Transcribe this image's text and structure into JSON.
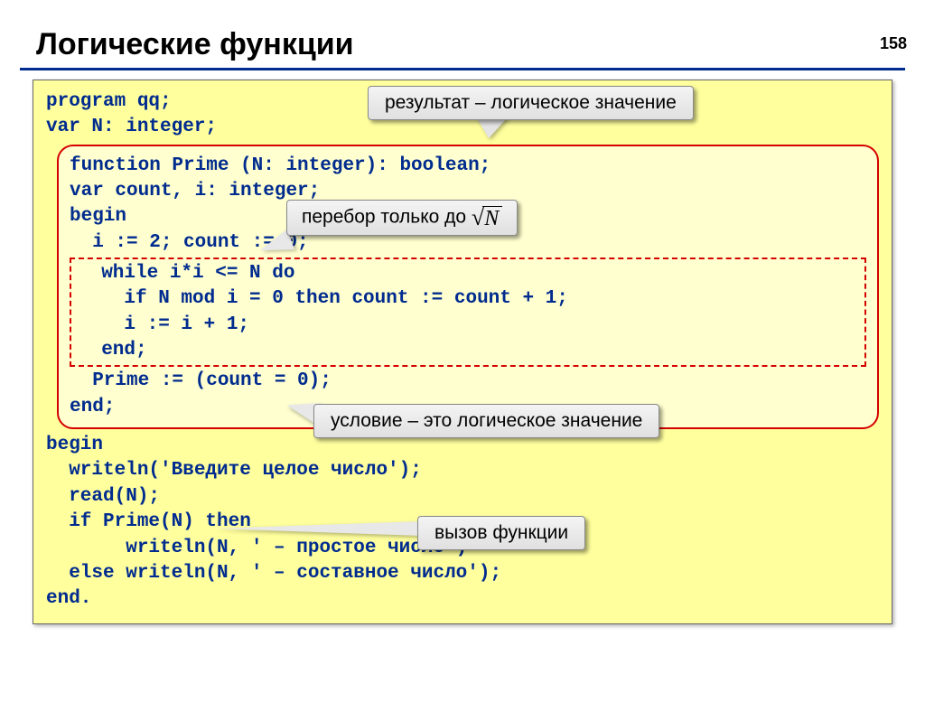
{
  "page_number": "158",
  "title": "Логические функции",
  "code": {
    "l1": "program qq;",
    "l2": "var N: integer;",
    "f1": "function Prime (N: integer): boolean;",
    "f2": "var count, i: integer;",
    "f3": "begin",
    "f4": "  i := 2; count := 0;",
    "d1": "  while i*i <= N do",
    "d2": "    if N mod i = 0 then count := count + 1;",
    "d3": "    i := i + 1;",
    "d4": "  end;",
    "f5": "  Prime := (count = 0);",
    "f6": "end;",
    "l3": "begin",
    "l4": "  writeln('Введите целое число');",
    "l5": "  read(N);",
    "l6": "  if Prime(N) then",
    "l7": "       writeln(N, ' – простое число')",
    "l8": "  else writeln(N, ' – составное число');",
    "l9": "end."
  },
  "callouts": {
    "c1": "результат – логическое значение",
    "c2_prefix": "перебор только до ",
    "c2_sqrt_arg": "N",
    "c3": "условие – это логическое значение",
    "c4": "вызов функции"
  }
}
